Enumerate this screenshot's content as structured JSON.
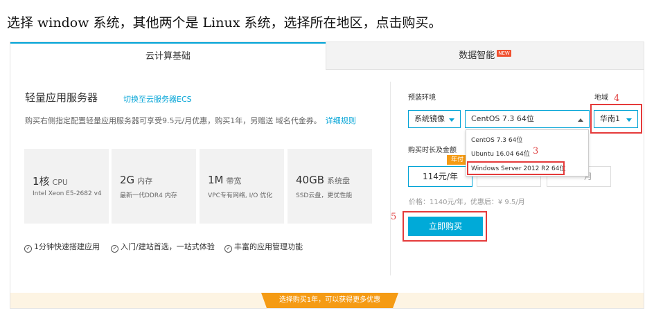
{
  "instruction": "选择 window 系统，其他两个是 Linux 系统，选择所在地区，点击购买。",
  "tabs": [
    {
      "label": "云计算基础",
      "active": true
    },
    {
      "label": "数据智能",
      "badge": "NEW",
      "active": false
    }
  ],
  "product": {
    "title": "轻量应用服务器",
    "switch_link": "切换至云服务器ECS",
    "desc": "购买右侧指定配置轻量应用服务器可享受9.5元/月优惠，购买1年，另赠送 域名代金券。",
    "rules_link": "详细规则",
    "specs": [
      {
        "value": "1核",
        "unit": "CPU",
        "sub": "Intel Xeon E5-2682 v4"
      },
      {
        "value": "2G",
        "unit": "内存",
        "sub": "最新一代DDR4 内存"
      },
      {
        "value": "1M",
        "unit": "带宽",
        "sub": "VPC专有网络, I/O 优化"
      },
      {
        "value": "40GB",
        "unit": "系统盘",
        "sub": "SSD云盘，更优性能"
      }
    ],
    "features": [
      "1分钟快速搭建应用",
      "入门/建站首选，一站式体验",
      "丰富的应用管理功能"
    ]
  },
  "order": {
    "env_label": "预装环境",
    "region_label": "地域",
    "image_type": "系统镜像",
    "os_selected": "CentOS 7.3 64位",
    "os_options": [
      "CentOS 7.3 64位",
      "Ubuntu 16.04 64位",
      "Windows Server 2012 R2 64位"
    ],
    "region_value": "华南1",
    "duration_label": "购买时长及金额",
    "pay_tag": "年付",
    "durations": [
      "114元/年",
      "",
      ""
    ],
    "duration_partial": [
      "",
      "月"
    ],
    "price_text": "价格：1140元/年，优惠后：¥ 9.5/月",
    "buy_label": "立即购买"
  },
  "annotations": {
    "n3": "3",
    "n4": "4",
    "n5": "5"
  },
  "banner": "选择购买1年，可以获得更多优惠",
  "colors": {
    "accent": "#00a3d6",
    "buy": "#00aad8",
    "orange": "#f59b14",
    "annotation": "#e53a3a"
  }
}
